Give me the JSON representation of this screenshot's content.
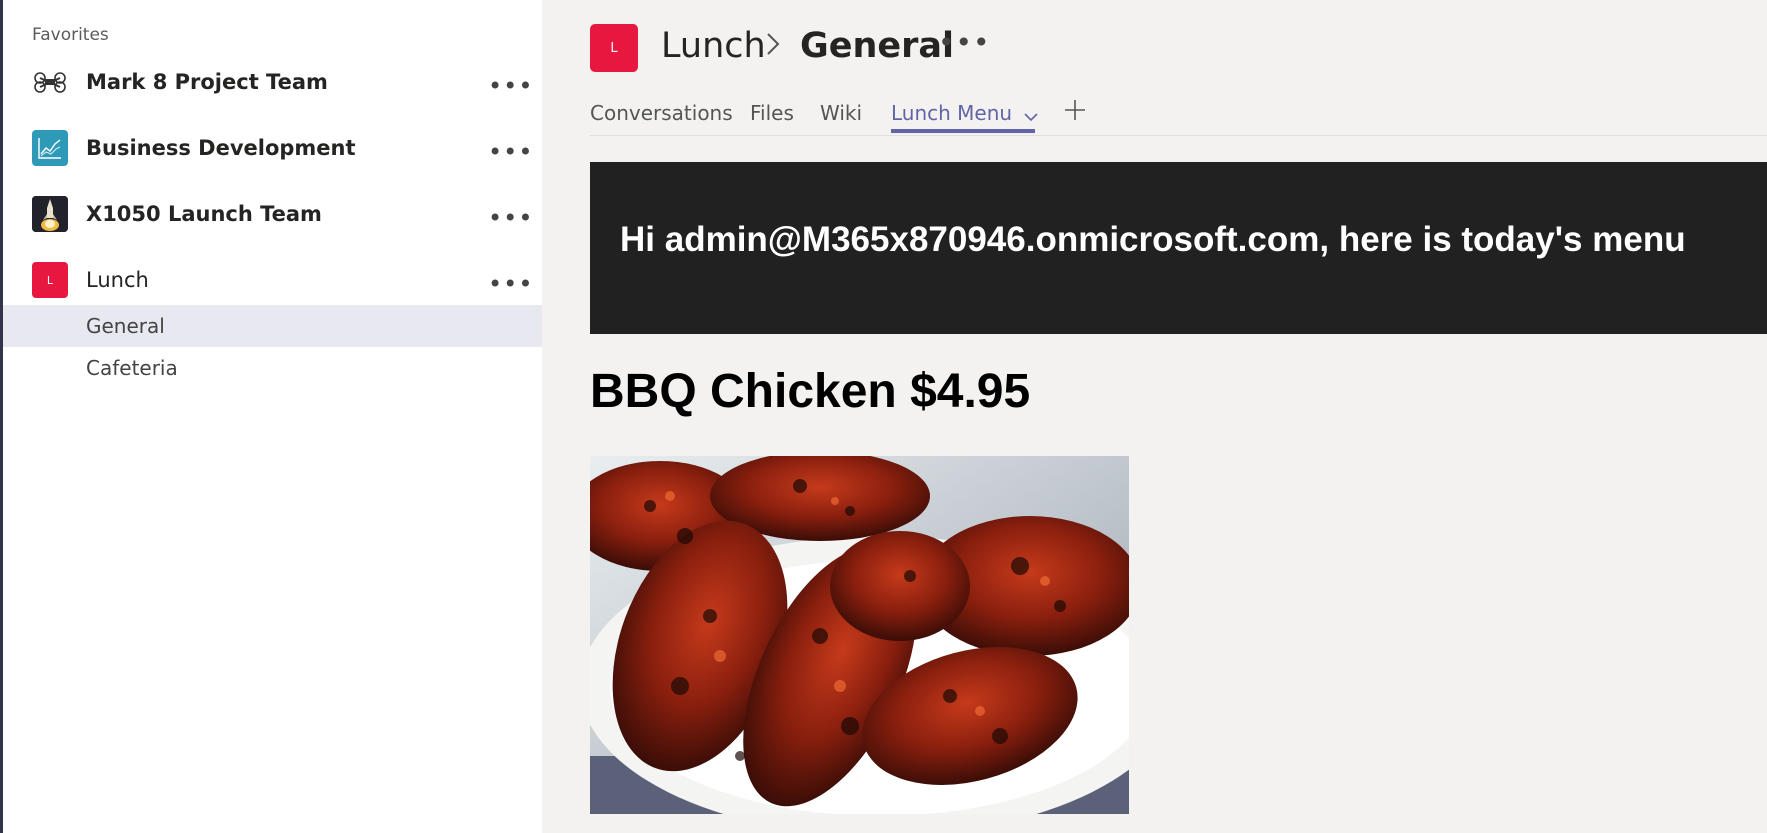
{
  "sidebar": {
    "favorites_label": "Favorites",
    "teams": [
      {
        "name": "Mark 8 Project Team",
        "icon": "drone-icon",
        "more": "•••"
      },
      {
        "name": "Business Development",
        "icon": "chart-icon",
        "more": "•••"
      },
      {
        "name": "X1050 Launch Team",
        "icon": "rocket-icon",
        "more": "•••"
      },
      {
        "name": "Lunch",
        "initial": "L",
        "more": "•••"
      }
    ],
    "channels": [
      {
        "name": "General",
        "active": true
      },
      {
        "name": "Cafeteria",
        "active": false
      }
    ]
  },
  "header": {
    "avatar_initial": "L",
    "team": "Lunch",
    "channel": "General",
    "more": "•••",
    "tabs": [
      {
        "label": "Conversations"
      },
      {
        "label": "Files"
      },
      {
        "label": "Wiki"
      },
      {
        "label": "Lunch Menu",
        "active": true
      }
    ]
  },
  "content": {
    "banner": "Hi admin@M365x870946.onmicrosoft.com, here is today's menu",
    "dish": "BBQ Chicken $4.95",
    "image": "bbq-chicken-photo"
  },
  "colors": {
    "accent": "#6264a7",
    "lunch_avatar": "#e8173f",
    "banner_bg": "#212121",
    "business_dev_avatar": "#2e9ab8"
  }
}
